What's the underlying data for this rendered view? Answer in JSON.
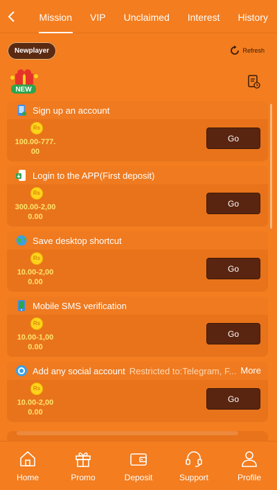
{
  "header": {
    "tabs": [
      {
        "label": "Mission",
        "active": true
      },
      {
        "label": "VIP",
        "active": false
      },
      {
        "label": "Unclaimed",
        "active": false
      },
      {
        "label": "Interest",
        "active": false
      },
      {
        "label": "History",
        "active": false
      }
    ]
  },
  "toolbar": {
    "badge": "Newplayer",
    "refresh_label": "Refresh",
    "gift_badge": "NEW"
  },
  "tasks": [
    {
      "title": "Sign up an account",
      "restriction": "",
      "more": "",
      "coin": "Rs",
      "amount_line1": "100.00-777.",
      "amount_line2": "00",
      "button": "Go",
      "icon": "phone-icon"
    },
    {
      "title": "Login to the APP(First deposit)",
      "restriction": "",
      "more": "",
      "coin": "Rs",
      "amount_line1": "300.00-2,00",
      "amount_line2": "0.00",
      "button": "Go",
      "icon": "app-download-icon"
    },
    {
      "title": "Save desktop shortcut",
      "restriction": "",
      "more": "",
      "coin": "Rs",
      "amount_line1": "10.00-2,00",
      "amount_line2": "0.00",
      "button": "Go",
      "icon": "globe-icon"
    },
    {
      "title": "Mobile SMS verification",
      "restriction": "",
      "more": "",
      "coin": "Rs",
      "amount_line1": "10.00-1,00",
      "amount_line2": "0.00",
      "button": "Go",
      "icon": "sms-phone-icon"
    },
    {
      "title": "Add any social account",
      "restriction": "Restricted to:Telegram, F...",
      "more": "More",
      "coin": "Rs",
      "amount_line1": "10.00-2,00",
      "amount_line2": "0.00",
      "button": "Go",
      "icon": "social-icon"
    }
  ],
  "nav": [
    {
      "label": "Home",
      "icon": "home-icon"
    },
    {
      "label": "Promo",
      "icon": "gift-icon"
    },
    {
      "label": "Deposit",
      "icon": "wallet-icon"
    },
    {
      "label": "Support",
      "icon": "headset-icon"
    },
    {
      "label": "Profile",
      "icon": "user-icon"
    }
  ],
  "colors": {
    "background": "#f37d1f",
    "card": "#e8731b",
    "button": "#5a2510",
    "amount": "#ffe46a",
    "coin": "#ffd21f"
  }
}
